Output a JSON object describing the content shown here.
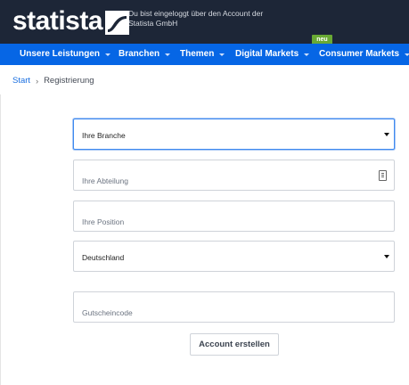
{
  "header": {
    "logo_text": "statista",
    "login_info": "Du bist eingeloggt über den Account der Statista GmbH"
  },
  "nav": {
    "items": [
      {
        "label": "Unsere Leistungen"
      },
      {
        "label": "Branchen"
      },
      {
        "label": "Themen"
      },
      {
        "label": "Digital Markets"
      },
      {
        "label": "Consumer Markets"
      }
    ],
    "new_badge": "neu"
  },
  "breadcrumb": {
    "home": "Start",
    "separator": "›",
    "current": "Registrierung"
  },
  "form": {
    "branche": {
      "value": "Ihre Branche"
    },
    "abteilung": {
      "placeholder": "Ihre Abteilung"
    },
    "position": {
      "placeholder": "Ihre Position"
    },
    "land": {
      "value": "Deutschland"
    },
    "gutschein": {
      "placeholder": "Gutscheincode"
    },
    "submit_label": "Account erstellen"
  },
  "colors": {
    "header_bg": "#1d2637",
    "nav_bg": "#0666e5",
    "badge": "#69a934",
    "link": "#1a6fe0"
  },
  "icons": [
    "statista-logo-mark-icon",
    "chevron-down-icon",
    "id-card-icon",
    "dropdown-arrow-icon"
  ]
}
